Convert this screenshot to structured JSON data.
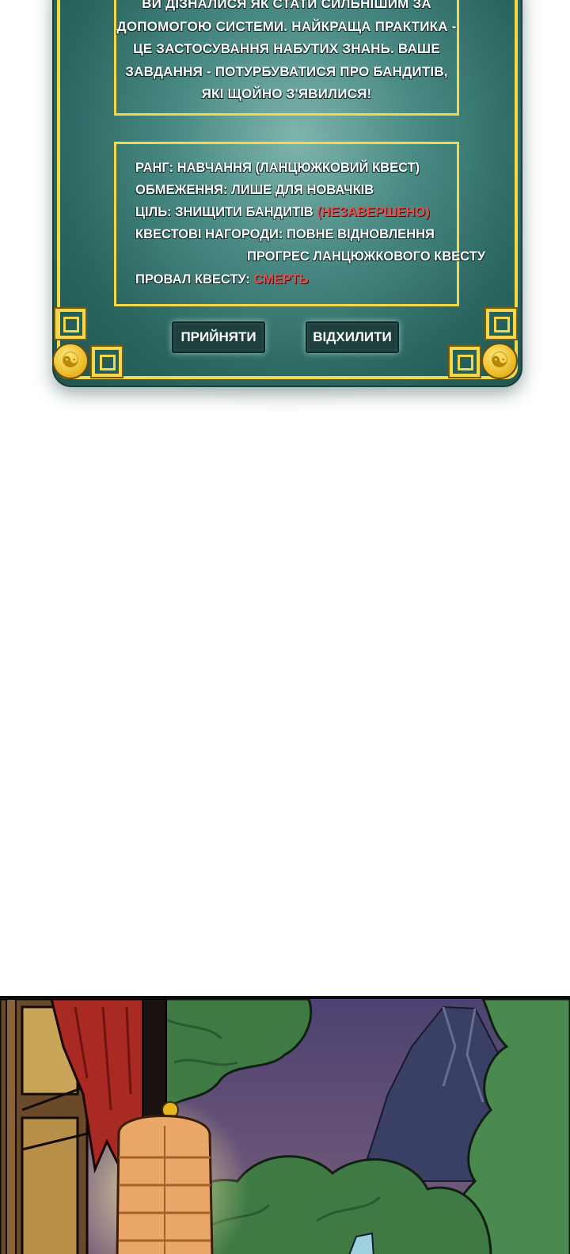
{
  "quest_panel": {
    "description_lines": [
      "ВИ ДІЗНАЛИСЯ ЯК СТАТИ СИЛЬНІШИМ ЗА",
      "ДОПОМОГОЮ СИСТЕМИ. НАЙКРАЩА ПРАКТИКА -",
      "ЦЕ ЗАСТОСУВАННЯ НАБУТИХ ЗНАНЬ. ВАШЕ",
      "ЗАВДАННЯ - ПОТУРБУВАТИСЯ ПРО БАНДИТІВ,",
      "ЯКІ ЩОЙНО З'ЯВИЛИСЯ!"
    ],
    "rank": "РАНГ: НАВЧАННЯ (ЛАНЦЮЖКОВИЙ КВЕСТ)",
    "restriction": "ОБМЕЖЕННЯ: ЛИШЕ ДЛЯ НОВАЧКІВ",
    "goal_label": "ЦІЛЬ: ЗНИЩИТИ БАНДИТІВ ",
    "goal_status": "(НЕЗАВЕРШЕНО)",
    "rewards_line1": "КВЕСТОВІ НАГОРОДИ: ПОВНЕ ВІДНОВЛЕННЯ",
    "rewards_line2": "ПРОГРЕС ЛАНЦЮЖКОВОГО КВЕСТУ",
    "failure_label": "ПРОВАЛ КВЕСТУ: ",
    "failure_value": "СМЕРТЬ",
    "accept_label": "ПРИЙНЯТИ",
    "decline_label": "ВІДХИЛИТИ",
    "colors": {
      "panel": "#3f807a",
      "frame": "#f5d84a",
      "status_red": "#e05050",
      "button": "#1d3f3e"
    }
  },
  "scene": {
    "icons": [
      "yin-yang-icon",
      "chinese-knot-ornament"
    ],
    "colors": {
      "sky": "#55486e",
      "foliage": "#3f7a45",
      "curtain": "#a82a22",
      "lantern": "#e9a868"
    }
  }
}
